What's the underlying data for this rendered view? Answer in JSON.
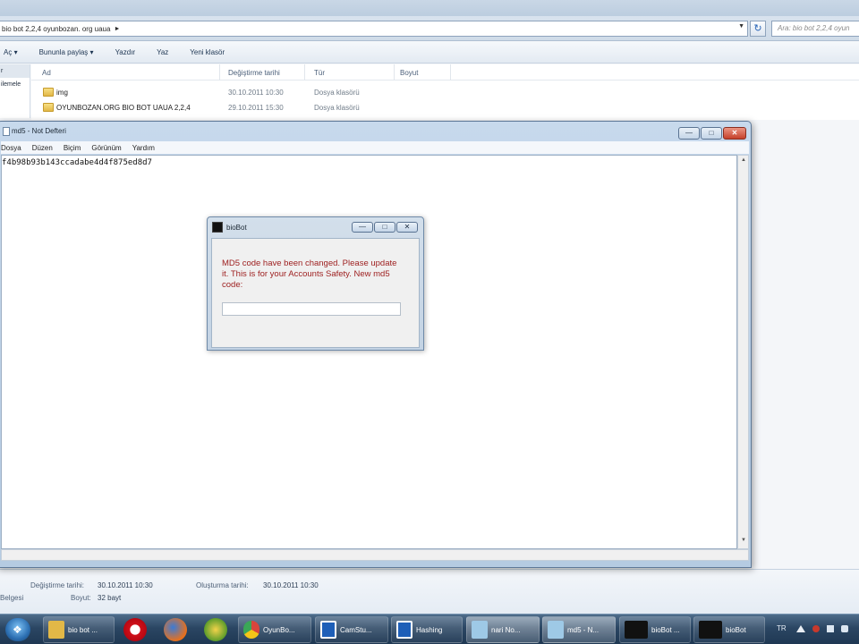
{
  "explorer": {
    "address_path": "bio bot 2,2,4 oyunbozan. org uaua",
    "search_placeholder": "Ara: bio bot 2,2,4 oyun",
    "toolbar": [
      "Aç",
      "Bununla paylaş",
      "Yazdır",
      "Yaz",
      "Yeni klasör"
    ],
    "nav_items": [
      "r",
      "ilemele"
    ],
    "columns": {
      "name": "Ad",
      "modified": "Değiştirme tarihi",
      "type": "Tür",
      "size": "Boyut"
    },
    "files": [
      {
        "name": "img",
        "modified": "30.10.2011 10:30",
        "type": "Dosya klasörü"
      },
      {
        "name": "OYUNBOZAN.ORG BIO BOT UAUA 2,2,4",
        "modified": "29.10.2011 15:30",
        "type": "Dosya klasörü"
      }
    ],
    "details": {
      "modified_label": "Değiştirme tarihi:",
      "modified_value": "30.10.2011 10:30",
      "created_label": "Oluşturma tarihi:",
      "created_value": "30.10.2011 10:30",
      "type_label": "Belgesi",
      "size_label": "Boyut:",
      "size_value": "32 bayt"
    }
  },
  "notepad": {
    "title": "md5 - Not Defteri",
    "menu": [
      "Dosya",
      "Düzen",
      "Biçim",
      "Görünüm",
      "Yardım"
    ],
    "content": "f4b98b93b143ccadabe4d4f875ed8d7"
  },
  "dialog": {
    "title": "bioBot",
    "message": "MD5 code have been changed. Please update it. This is for your Accounts Safety. New md5 code:",
    "input_value": ""
  },
  "taskbar": {
    "buttons": [
      {
        "label": "bio bot ...",
        "icon": "folder-icon",
        "color": "#e2b847"
      },
      {
        "label": "OyunBo...",
        "icon": "chrome-icon",
        "color": "#d9453c"
      },
      {
        "label": "CamStu...",
        "icon": "camstudio-icon",
        "color": "#1e5fb8"
      },
      {
        "label": "Hashing",
        "icon": "hashing-icon",
        "color": "#1e5fb8"
      },
      {
        "label": "nari No...",
        "icon": "notepad-icon",
        "color": "#9ec9e6"
      },
      {
        "label": "md5 - N...",
        "icon": "notepad-icon",
        "color": "#9ec9e6"
      },
      {
        "label": "bioBot ...",
        "icon": "biobot-icon",
        "color": "#111111"
      },
      {
        "label": "bioBot",
        "icon": "biobot-icon",
        "color": "#111111"
      }
    ],
    "pinned": [
      "opera-icon",
      "firefox-icon",
      "app-icon"
    ],
    "language": "TR"
  }
}
